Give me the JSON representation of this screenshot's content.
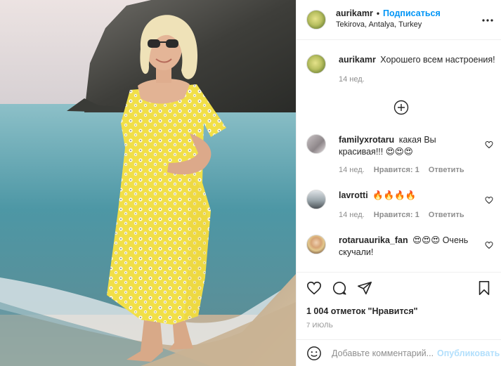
{
  "post": {
    "author": "aurikamr",
    "separator": "•",
    "follow_label": "Подписаться",
    "location": "Tekirova, Antalya, Turkey",
    "more_label": "•••",
    "caption_user": "aurikamr",
    "caption_text": "Хорошего всем настроения!",
    "caption_time": "14 нед."
  },
  "comments": [
    {
      "user": "familyxrotaru",
      "text": "какая Вы красивая!!! 😍😍😍",
      "time": "14 нед.",
      "likes": "Нравится: 1",
      "reply": "Ответить"
    },
    {
      "user": "lavrotti",
      "text": "🔥🔥🔥🔥",
      "time": "14 нед.",
      "likes": "Нравится: 1",
      "reply": "Ответить"
    },
    {
      "user": "rotaruaurika_fan",
      "text": "😍😍😍 Очень скучали!"
    }
  ],
  "footer": {
    "likes_text": "1 004 отметок \"Нравится\"",
    "date": "7 ИЮЛЬ",
    "add_comment_placeholder": "Добавьте комментарий...",
    "publish_label": "Опубликовать"
  },
  "icons": {
    "more": "more-options-icon",
    "load_more": "plus-circle-icon",
    "like": "heart-icon",
    "comment": "comment-icon",
    "share": "paper-plane-icon",
    "save": "bookmark-icon",
    "emoji": "smiley-icon"
  },
  "colors": {
    "accent": "#0095f6",
    "publish_disabled": "#b2dffc",
    "muted": "#8e8e8e"
  }
}
